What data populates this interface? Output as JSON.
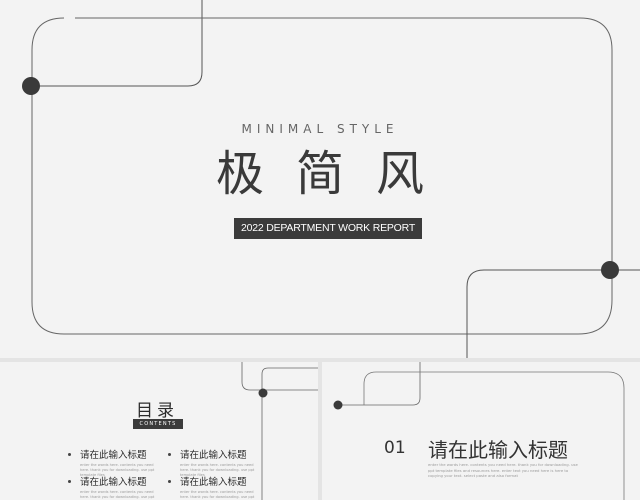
{
  "main_slide": {
    "subtitle": "MINIMAL STYLE",
    "title": "极简风",
    "badge": "2022 DEPARTMENT WORK REPORT"
  },
  "toc_slide": {
    "title": "目录",
    "subtitle": "CONTENTS",
    "items": [
      {
        "label": "请在此输入标题",
        "desc": "enter the words here. contents you need here. thank you for downloading. use ppt template files"
      },
      {
        "label": "请在此输入标题",
        "desc": "enter the words here. contents you need here. thank you for downloading. use ppt template files"
      },
      {
        "label": "请在此输入标题",
        "desc": "enter the words here. contents you need here. thank you for downloading. use ppt template files"
      },
      {
        "label": "请在此输入标题",
        "desc": "enter the words here. contents you need here. thank you for downloading. use ppt template files"
      }
    ]
  },
  "chapter_slide": {
    "number": "01",
    "title": "请在此输入标题",
    "desc": "enter the words here. contents you need here. thank you for downloading. use ppt template files and resources here. enter text you need here is here to copying your text. select paste and also format"
  },
  "colors": {
    "background": "#f3f3f3",
    "line": "#555555",
    "dot": "#3a3a3a",
    "badge": "#3b3b3b"
  }
}
